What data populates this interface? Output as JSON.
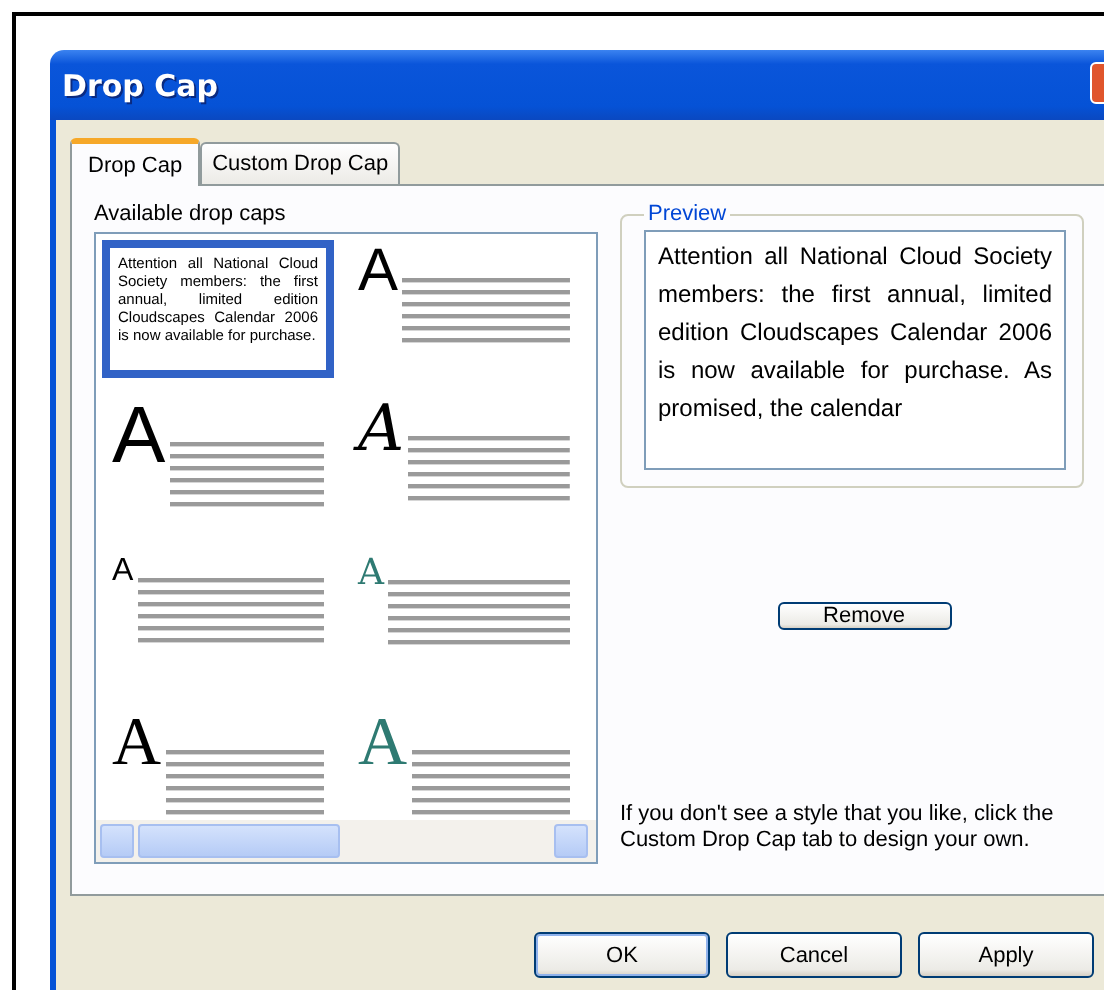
{
  "window": {
    "title": "Drop Cap"
  },
  "tabs": [
    {
      "label": "Drop Cap",
      "selected": true
    },
    {
      "label": "Custom Drop Cap",
      "selected": false
    }
  ],
  "available": {
    "label": "Available drop caps",
    "items": [
      {
        "kind": "plain",
        "selected": true,
        "text": "Attention all National Cloud Society members: the first annual, limited edition Cloudscapes Calendar 2006 is now available for purchase."
      },
      {
        "kind": "large",
        "selected": false,
        "letter": "A"
      },
      {
        "kind": "tall",
        "selected": false,
        "letter": "A"
      },
      {
        "kind": "script",
        "selected": false,
        "letter": "A"
      },
      {
        "kind": "small",
        "selected": false,
        "letter": "A"
      },
      {
        "kind": "double",
        "selected": false,
        "letter": "A",
        "color": "#2e7a72"
      },
      {
        "kind": "serif",
        "selected": false,
        "letter": "A"
      },
      {
        "kind": "serif",
        "selected": false,
        "letter": "A",
        "color": "#2e7a72"
      }
    ]
  },
  "preview": {
    "legend": "Preview",
    "text": "Attention all National Cloud Society members: the first annual, limited edition Cloudscapes Calendar 2006 is now available for purchase. As promised, the calendar"
  },
  "remove_button": "Remove",
  "hint": "If you don't see a style that you like, click the Custom Drop Cap tab to design your own.",
  "buttons": [
    "OK",
    "Cancel",
    "Apply"
  ]
}
